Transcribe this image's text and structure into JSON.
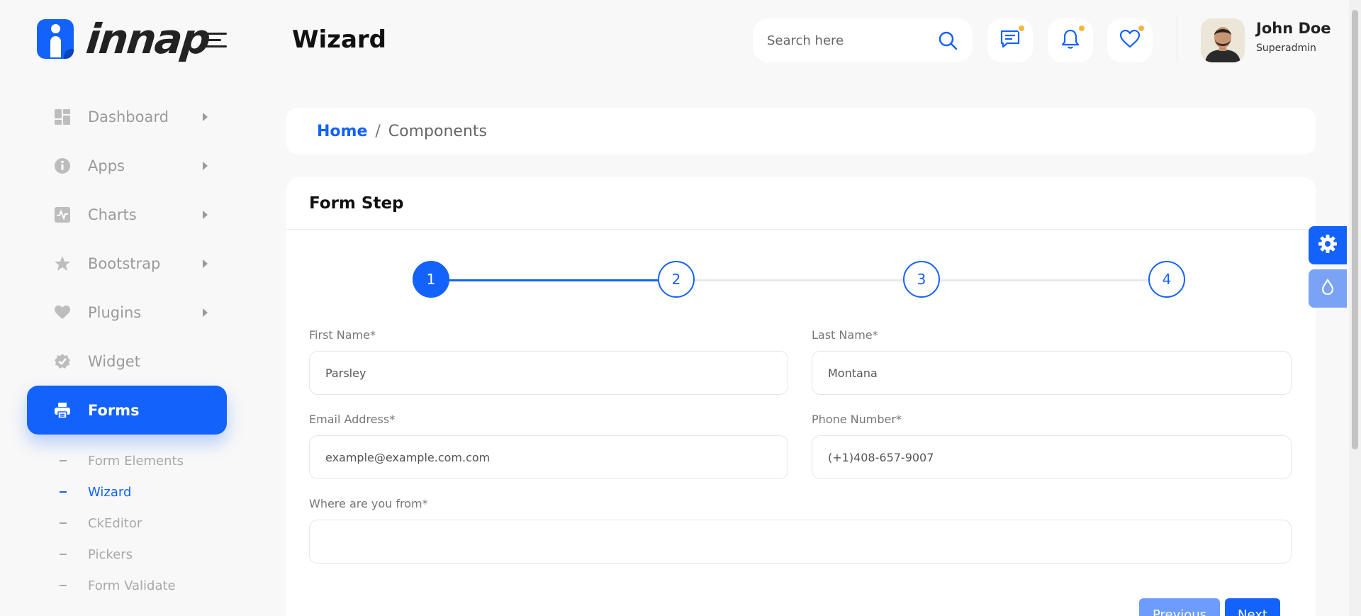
{
  "brand": {
    "name": "innap"
  },
  "header": {
    "page_title": "Wizard",
    "search_placeholder": "Search here",
    "user": {
      "name": "John Doe",
      "role": "Superadmin"
    },
    "notification_dot_color": "#f6b53b"
  },
  "sidebar": {
    "items": [
      {
        "label": "Dashboard",
        "icon": "dashboard-icon",
        "has_caret": true
      },
      {
        "label": "Apps",
        "icon": "info-icon",
        "has_caret": true
      },
      {
        "label": "Charts",
        "icon": "chart-icon",
        "has_caret": true
      },
      {
        "label": "Bootstrap",
        "icon": "star-icon",
        "has_caret": true
      },
      {
        "label": "Plugins",
        "icon": "heart-icon",
        "has_caret": true
      },
      {
        "label": "Widget",
        "icon": "badge-check-icon",
        "has_caret": false
      },
      {
        "label": "Forms",
        "icon": "printer-icon",
        "active": true
      }
    ],
    "sub_items": [
      {
        "label": "Form Elements"
      },
      {
        "label": "Wizard",
        "active": true
      },
      {
        "label": "CkEditor"
      },
      {
        "label": "Pickers"
      },
      {
        "label": "Form Validate"
      }
    ]
  },
  "breadcrumb": {
    "home": "Home",
    "separator": "/",
    "current": "Components"
  },
  "form": {
    "title": "Form Step",
    "steps": [
      "1",
      "2",
      "3",
      "4"
    ],
    "current_step": 1,
    "fields": {
      "first_name": {
        "label": "First Name*",
        "value": "Parsley"
      },
      "last_name": {
        "label": "Last Name*",
        "value": "Montana"
      },
      "email": {
        "label": "Email Address*",
        "value": "example@example.com.com"
      },
      "phone": {
        "label": "Phone Number*",
        "value": "(+1)408-657-9007"
      },
      "origin": {
        "label": "Where are you from*",
        "value": ""
      }
    },
    "buttons": {
      "previous": "Previous",
      "next": "Next"
    }
  },
  "colors": {
    "primary": "#1362fc",
    "primary_light": "#6c9cfc",
    "sidebar_text": "#9a9a9a"
  }
}
